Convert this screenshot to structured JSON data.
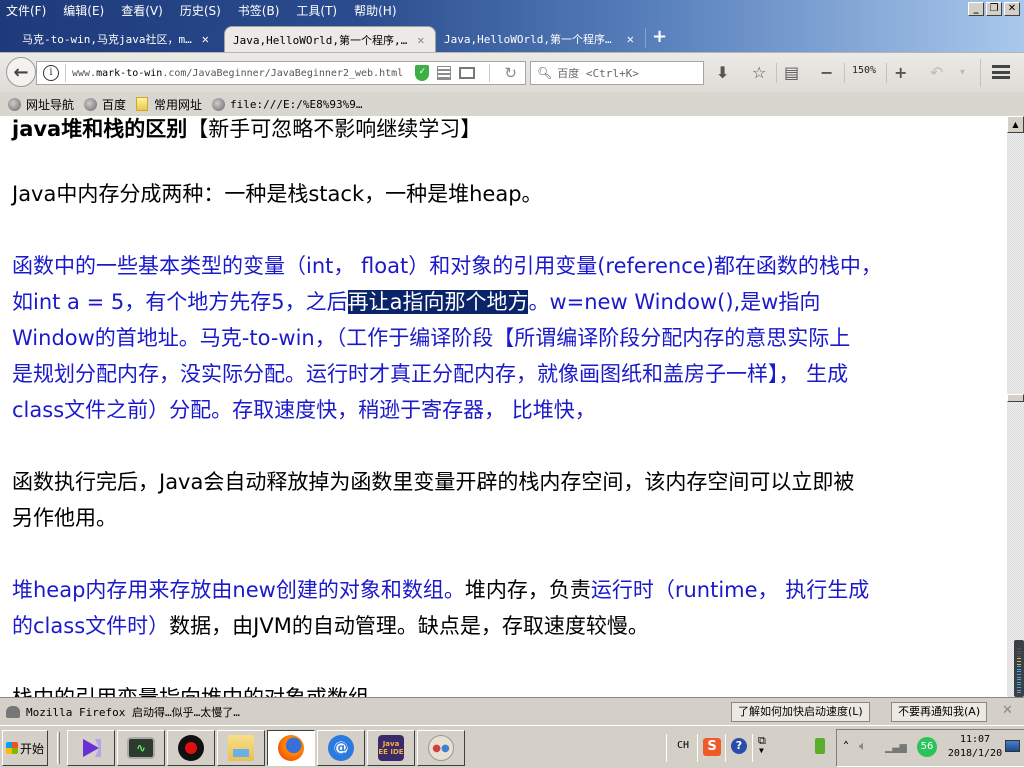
{
  "menubar": {
    "items": [
      "文件(F)",
      "编辑(E)",
      "查看(V)",
      "历史(S)",
      "书签(B)",
      "工具(T)",
      "帮助(H)"
    ]
  },
  "window_controls": {
    "minimize": "_",
    "restore": "❐",
    "close": "✕"
  },
  "tabs": [
    {
      "title": "马克-to-win,马克java社区，m…",
      "active": false
    },
    {
      "title": "Java,HelloWOrld,第一个程序,…",
      "active": true
    },
    {
      "title": "Java,HelloWOrld,第一个程序,…",
      "active": false
    }
  ],
  "new_tab_label": "+",
  "navbar": {
    "url_prefix": "www.",
    "url_domain": "mark-to-win",
    "url_rest": ".com/JavaBeginner/JavaBeginner2_web.html",
    "search_placeholder": "百度 <Ctrl+K>",
    "zoom_level": "150%",
    "icons": [
      "back-icon",
      "info-icon",
      "shield-icon",
      "qr-code-icon",
      "reader-view-icon",
      "reload-icon",
      "search-icon",
      "download-icon",
      "bookmark-star-icon",
      "clipboard-icon",
      "zoom-out-icon",
      "zoom-in-icon",
      "undo-icon",
      "menu-icon"
    ]
  },
  "bookmarks": [
    {
      "label": "网址导航",
      "icon": "globe-icon"
    },
    {
      "label": "百度",
      "icon": "globe-icon"
    },
    {
      "label": "常用网址",
      "icon": "folder-icon"
    },
    {
      "label": "file:///E:/%E8%93%9…",
      "icon": "globe-icon"
    }
  ],
  "content": {
    "heading_bold": "java堆和栈的区别",
    "heading_rest": "【新手可忽略不影响继续学习】",
    "p1": "Java中内存分成两种：一种是栈stack，一种是堆heap。",
    "p2_line1": "函数中的一些基本类型的变量（int， float）和对象的引用变量(reference)都在函数的栈中，",
    "p2_line2_a": "如int a = 5，有个地方先存5，之后",
    "p2_line2_selected": "再让a指向那个地方",
    "p2_line2_b": "。w=new Window(),是w指向",
    "p2_line3": "Window的首地址。马克-to-win，（工作于编译阶段【所谓编译阶段分配内存的意思实际上",
    "p2_line4": "是规划分配内存，没实际分配。运行时才真正分配内存，就像画图纸和盖房子一样】， 生成",
    "p2_line5": "class文件之前）分配。存取速度快，稍逊于寄存器， 比堆快，",
    "p3_line1": "函数执行完后，Java会自动释放掉为函数里变量开辟的栈内存空间，该内存空间可以立即被",
    "p3_line2": "另作他用。",
    "p4_blue_a": "堆heap内存用来存放由new创建的对象和数组。",
    "p4_black_a": "堆内存，负责",
    "p4_blue_b": "运行时（runtime， 执行生成",
    "p4_blue_c": "的class文件时）",
    "p4_black_b": "数据，由JVM的自动管理。缺点是，存取速度较慢。",
    "p5": "栈中的引用变量指向堆中的对象或数组。"
  },
  "scrollbar": {
    "position_fraction": 0.47
  },
  "notification": {
    "text": "Mozilla Firefox 启动得…似乎…太慢了…",
    "button_learn": "了解如何加快启动速度(L)",
    "button_dismiss": "不要再通知我(A)",
    "close": "✕"
  },
  "taskbar": {
    "start_label": "开始",
    "apps": [
      {
        "name": "visual-studio-icon",
        "active": false
      },
      {
        "name": "system-monitor-icon",
        "active": false
      },
      {
        "name": "screen-recorder-icon",
        "active": false
      },
      {
        "name": "file-explorer-icon",
        "active": false
      },
      {
        "name": "firefox-icon",
        "active": true
      },
      {
        "name": "email-client-icon",
        "active": false
      },
      {
        "name": "java-ee-ide-icon",
        "active": false,
        "label": "Java EE IDE"
      },
      {
        "name": "paint-icon",
        "active": false
      }
    ],
    "tray": {
      "language": "CH",
      "sogou": "S",
      "help": "?",
      "badge": "56",
      "time": "11:07",
      "date": "2018/1/20"
    }
  }
}
